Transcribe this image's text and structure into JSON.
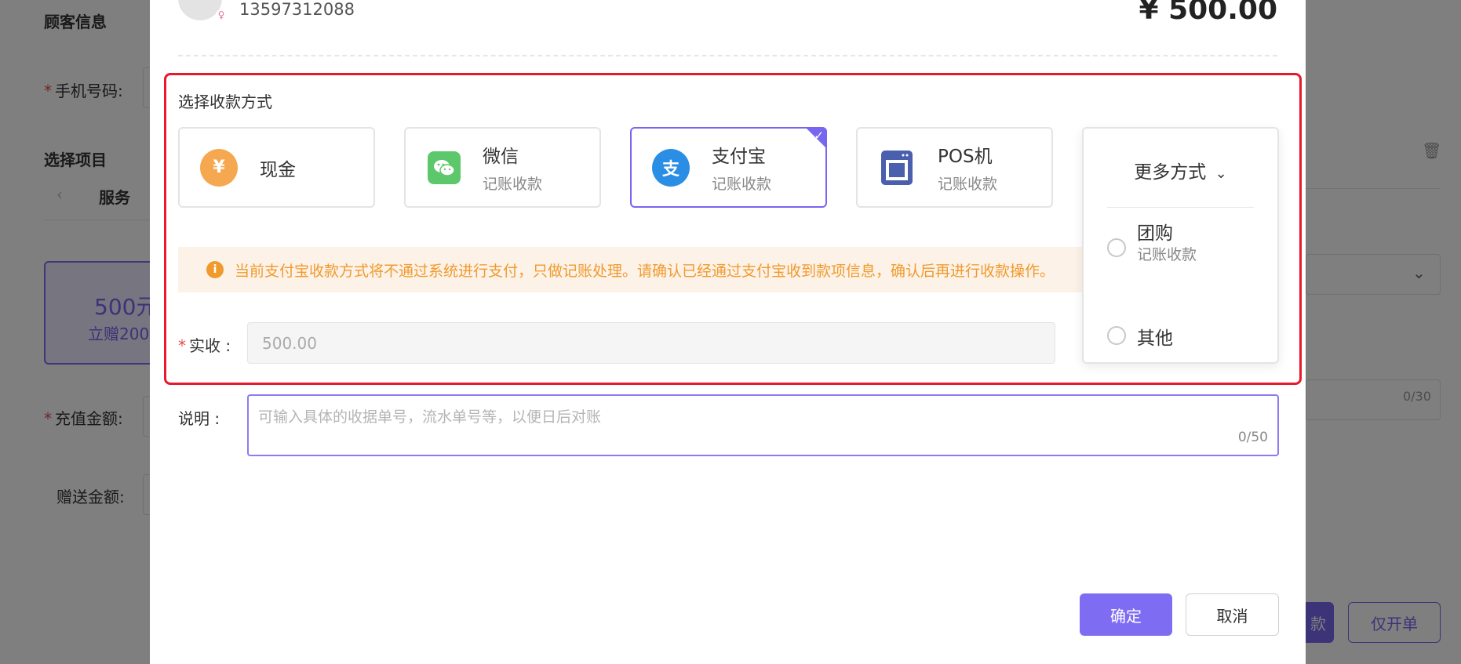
{
  "background": {
    "customer_info": "顾客信息",
    "phone_label": "手机号码:",
    "select_item": "选择项目",
    "tab_service": "服务",
    "card_amount": "500元",
    "card_gift": "立赠200",
    "recharge_label": "充值金额:",
    "gift_label": "赠送金额:",
    "counter": "0/30",
    "btn_pay_partial": "款",
    "btn_only_order": "仅开单"
  },
  "customer": {
    "phone": "13597312088",
    "total": "¥ 500.00"
  },
  "payment": {
    "section_title": "选择收款方式",
    "methods": [
      {
        "name": "现金",
        "sub": "",
        "icon": "cash-icon",
        "color": "#f5a84f"
      },
      {
        "name": "微信",
        "sub": "记账收款",
        "icon": "wechat-icon",
        "color": "#5dc86b"
      },
      {
        "name": "支付宝",
        "sub": "记账收款",
        "icon": "alipay-icon",
        "color": "#2a8ee4",
        "selected": true
      },
      {
        "name": "POS机",
        "sub": "记账收款",
        "icon": "pos-icon",
        "color": "#4a5fae"
      }
    ],
    "more": {
      "title": "更多方式",
      "options": [
        {
          "name": "团购",
          "sub": "记账收款"
        },
        {
          "name": "其他",
          "sub": ""
        }
      ]
    },
    "alert_text": "当前支付宝收款方式将不通过系统进行支付，只做记账处理。请确认已经通过支付宝收到款项信息，确认后再进行收款操作。",
    "received_label": "实收",
    "received_value": "500.00",
    "note_label": "说明",
    "note_placeholder": "可输入具体的收据单号，流水单号等，以便日后对账",
    "note_counter": "0/50"
  },
  "actions": {
    "confirm": "确定",
    "cancel": "取消"
  }
}
